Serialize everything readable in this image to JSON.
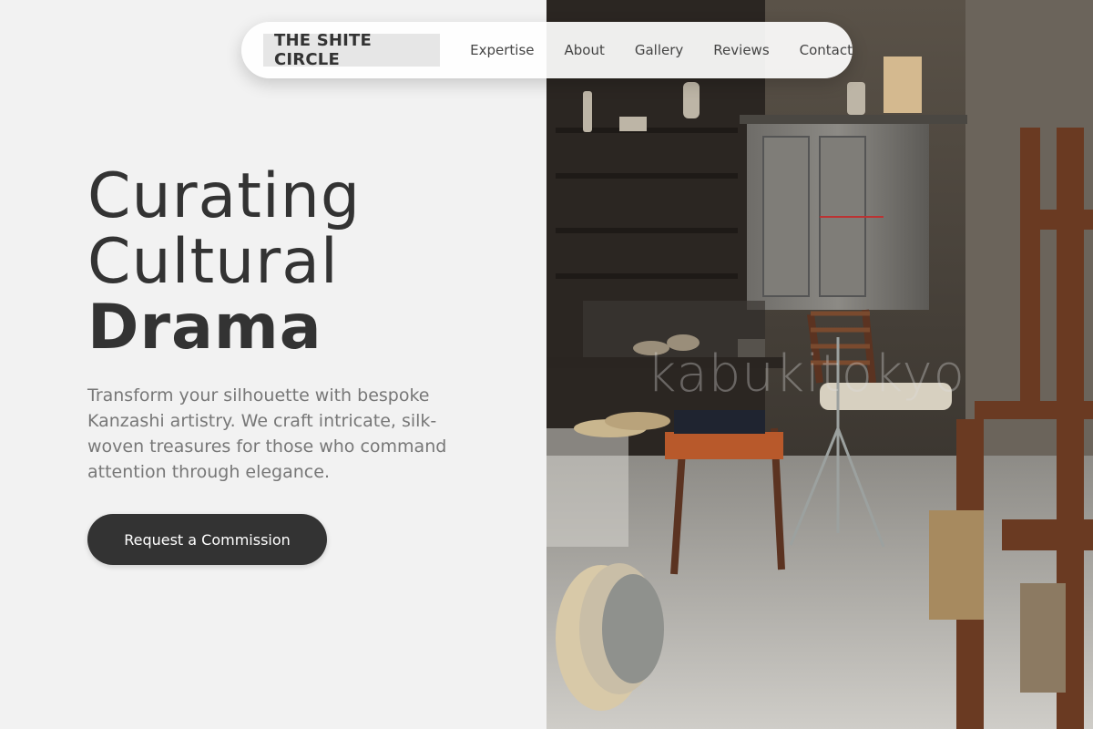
{
  "nav": {
    "brand": "THE SHITE CIRCLE",
    "links": [
      "Expertise",
      "About",
      "Gallery",
      "Reviews",
      "Contact"
    ]
  },
  "hero": {
    "title_lines": [
      "Curating",
      "Cultural",
      "Drama"
    ],
    "description": "Transform your silhouette with bespoke Kanzashi artistry. We craft intricate, silk-woven treasures for those who command attention through elegance.",
    "cta_label": "Request a Commission"
  },
  "photo": {
    "watermark": "kabukitokyo"
  },
  "colors": {
    "background": "#f2f2f2",
    "text_dark": "#333333",
    "text_muted": "#777777",
    "button": "#333333"
  }
}
